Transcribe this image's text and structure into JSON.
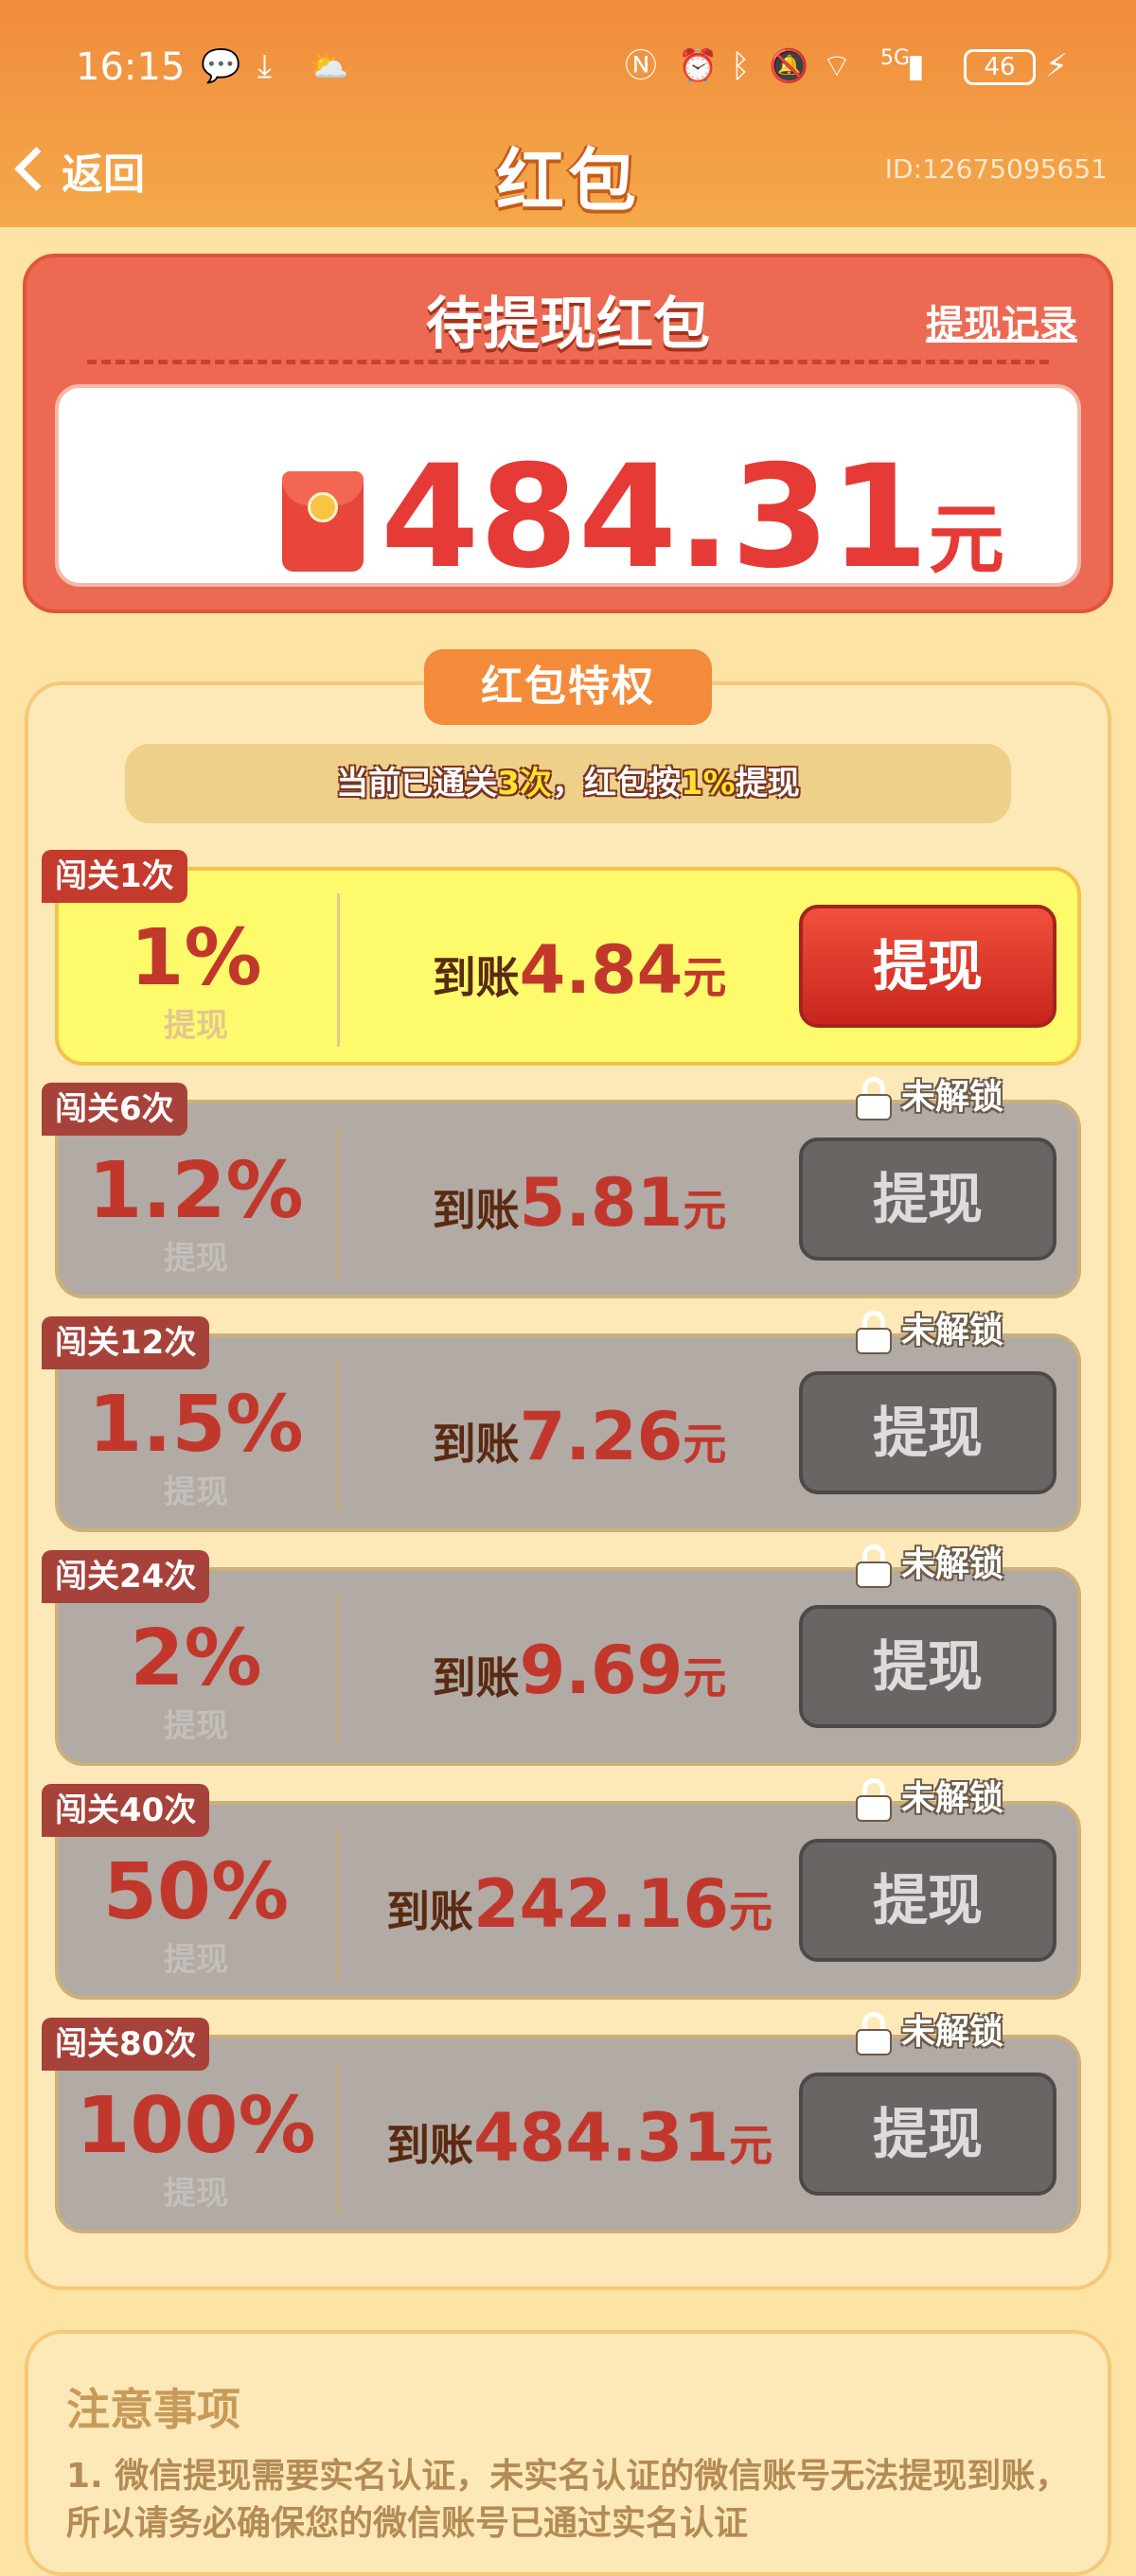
{
  "status_bar": {
    "time": "16:15",
    "network": "5G",
    "battery": "46",
    "icons": [
      "wechat-icon",
      "download-icon",
      "weather-icon",
      "nfc-icon",
      "alarm-icon",
      "bluetooth-icon",
      "mute-icon",
      "wifi-icon",
      "signal-icon",
      "charging-icon"
    ]
  },
  "header": {
    "back_label": "返回",
    "title": "红包",
    "user_id": "ID:12675095651"
  },
  "pending": {
    "title": "待提现红包",
    "record_link": "提现记录",
    "amount": "484.31",
    "unit": "元"
  },
  "privilege": {
    "tag": "红包特权",
    "notice_prefix": "当前已通关",
    "notice_count": "3次",
    "notice_middle": "，红包按",
    "notice_rate": "1%",
    "notice_suffix": "提现"
  },
  "tiers": [
    {
      "level": "闯关1次",
      "percent": "1%",
      "percent_label": "提现",
      "receive_label": "到账",
      "receive_value": "4.84",
      "receive_unit": "元",
      "button": "提现",
      "locked": false
    },
    {
      "level": "闯关6次",
      "percent": "1.2%",
      "percent_label": "提现",
      "receive_label": "到账",
      "receive_value": "5.81",
      "receive_unit": "元",
      "button": "提现",
      "locked": true,
      "lock_label": "未解锁"
    },
    {
      "level": "闯关12次",
      "percent": "1.5%",
      "percent_label": "提现",
      "receive_label": "到账",
      "receive_value": "7.26",
      "receive_unit": "元",
      "button": "提现",
      "locked": true,
      "lock_label": "未解锁"
    },
    {
      "level": "闯关24次",
      "percent": "2%",
      "percent_label": "提现",
      "receive_label": "到账",
      "receive_value": "9.69",
      "receive_unit": "元",
      "button": "提现",
      "locked": true,
      "lock_label": "未解锁"
    },
    {
      "level": "闯关40次",
      "percent": "50%",
      "percent_label": "提现",
      "receive_label": "到账",
      "receive_value": "242.16",
      "receive_unit": "元",
      "button": "提现",
      "locked": true,
      "lock_label": "未解锁"
    },
    {
      "level": "闯关80次",
      "percent": "100%",
      "percent_label": "提现",
      "receive_label": "到账",
      "receive_value": "484.31",
      "receive_unit": "元",
      "button": "提现",
      "locked": true,
      "lock_label": "未解锁"
    }
  ],
  "notes": {
    "title": "注意事项",
    "item1": "1. 微信提现需要实名认证，未实名认证的微信账号无法提现到账，所以请务必确保您的微信账号已通过实名认证"
  },
  "colors": {
    "header_orange": "#f08c3c",
    "card_red": "#ec6a53",
    "amount_red": "#e53a36",
    "active_tier": "#fdfa6c",
    "locked_tier": "#b1aaa5",
    "button_red": "#d8372a",
    "button_gray": "#686563"
  }
}
